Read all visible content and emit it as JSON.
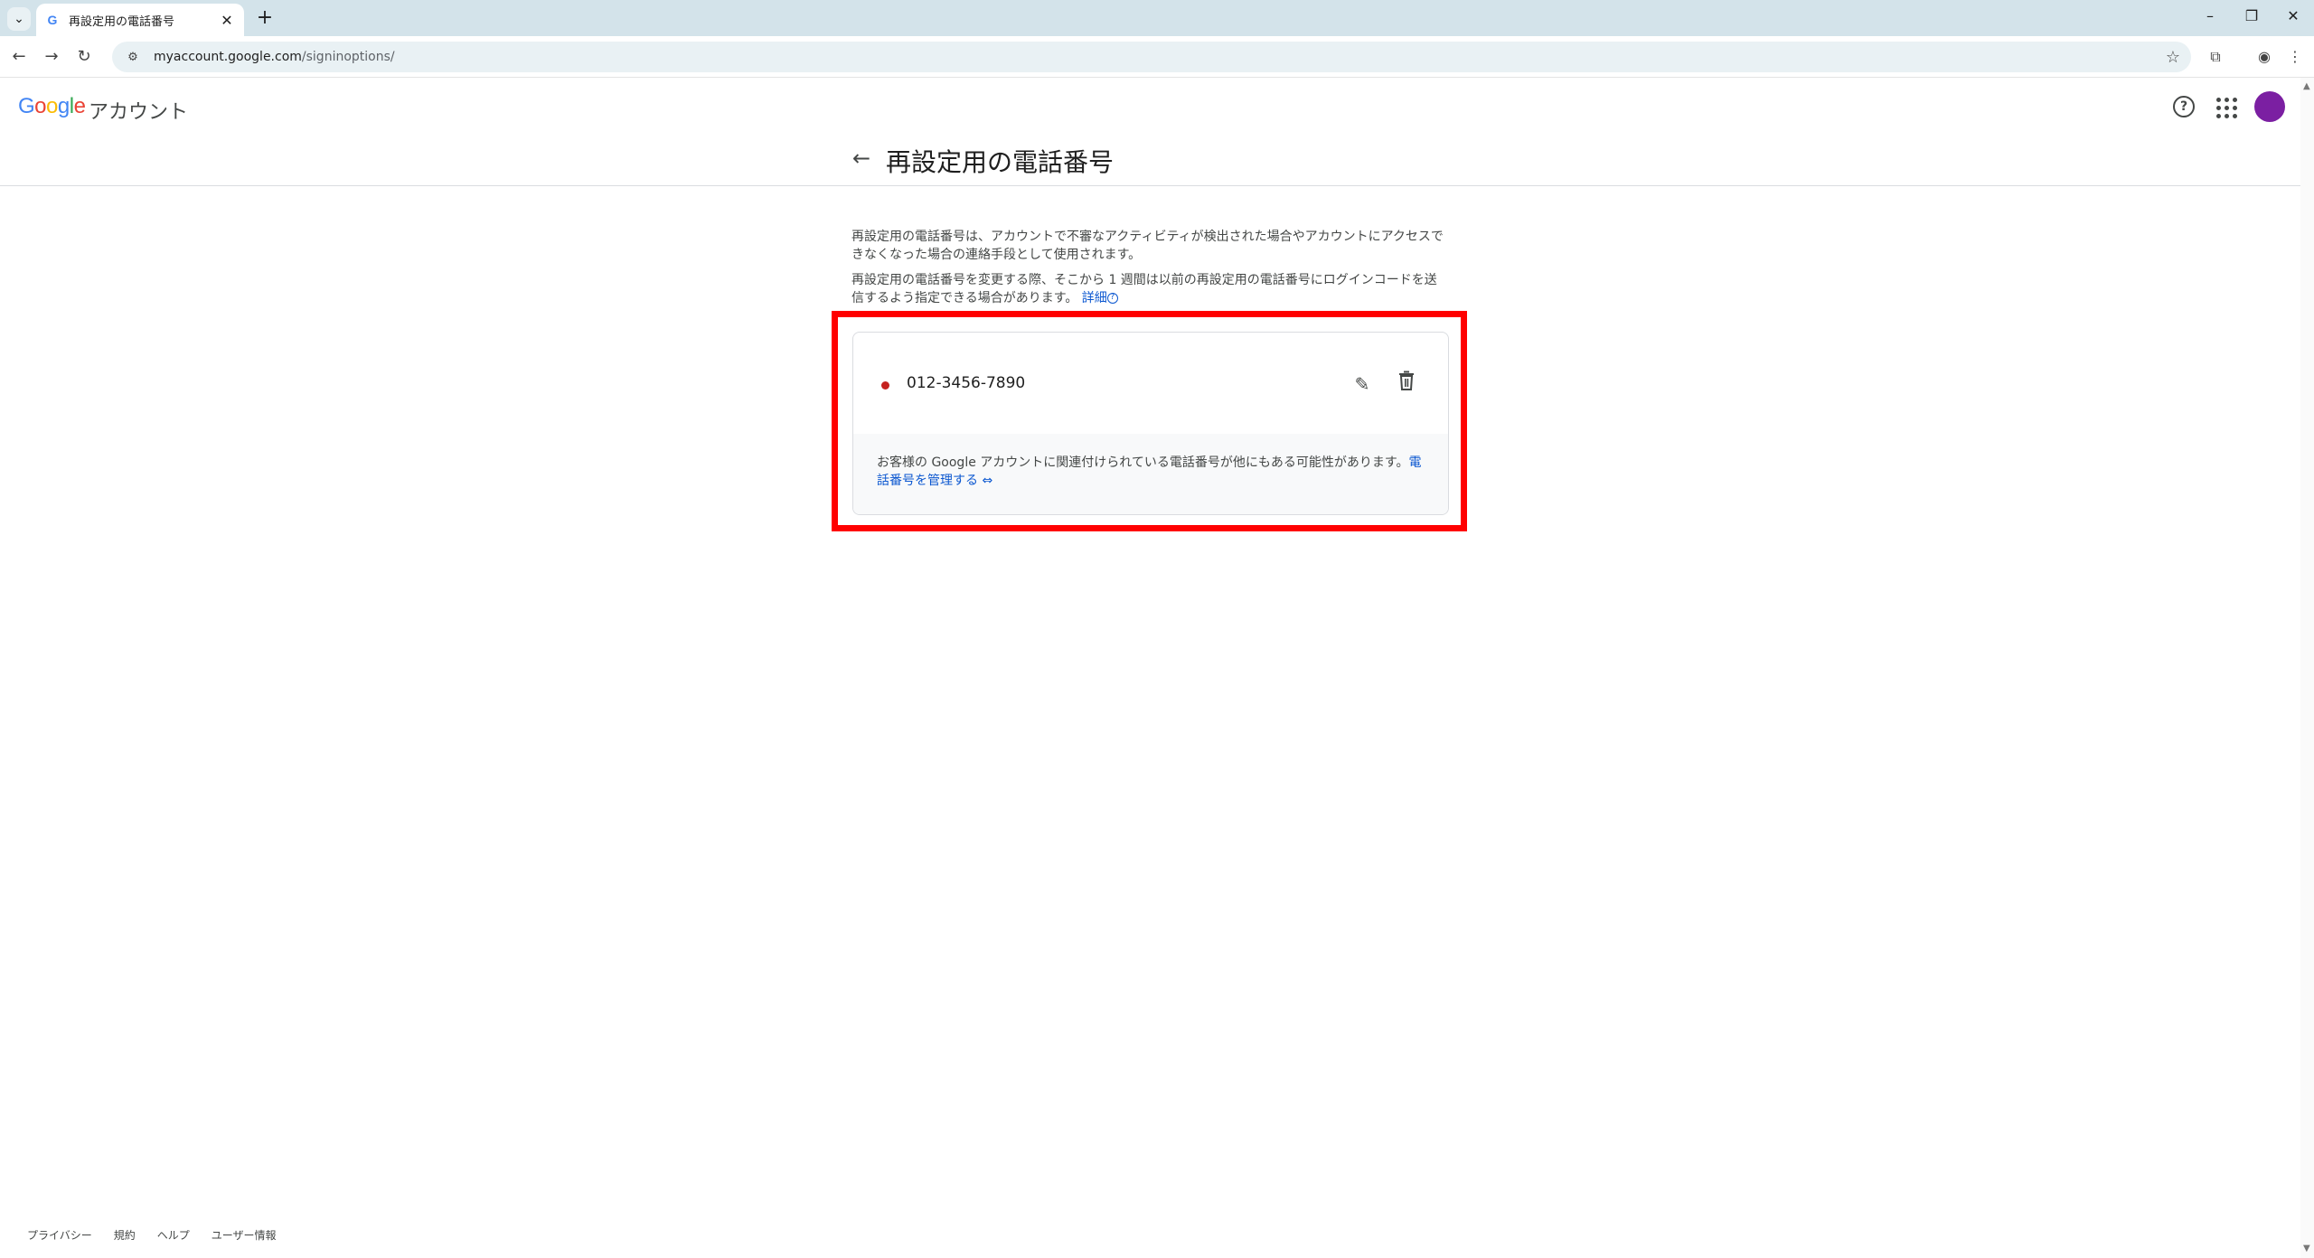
{
  "browser": {
    "tab_title": "再設定用の電話番号",
    "url_host": "myaccount.google.com",
    "url_path": "/signinoptions/",
    "new_tab_symbol": "+",
    "close_symbol": "✕"
  },
  "header": {
    "logo_letters": [
      "G",
      "o",
      "o",
      "g",
      "l",
      "e"
    ],
    "product_name": "アカウント",
    "help_symbol": "?"
  },
  "page": {
    "title": "再設定用の電話番号",
    "description_1": "再設定用の電話番号は、アカウントで不審なアクティビティが検出された場合やアカウントにアクセスできなくなった場合の連絡手段として使用されます。",
    "description_2": "再設定用の電話番号を変更する際、そこから 1 週間は以前の再設定用の電話番号にログインコードを送信するよう指定できる場合があります。",
    "details_link": "詳細"
  },
  "phone_card": {
    "number": "012-3456-7890",
    "status_color": "#c5221f",
    "note_text": "お客様の Google アカウントに関連付けられている電話番号が他にもある可能性があります。",
    "manage_link": "電話番号を管理する"
  },
  "footer": {
    "links": [
      "プライバシー",
      "規約",
      "ヘルプ",
      "ユーザー情報"
    ]
  },
  "colors": {
    "accent": "#0b57d0",
    "highlight": "#ff0000",
    "avatar": "#7b1fa2"
  }
}
